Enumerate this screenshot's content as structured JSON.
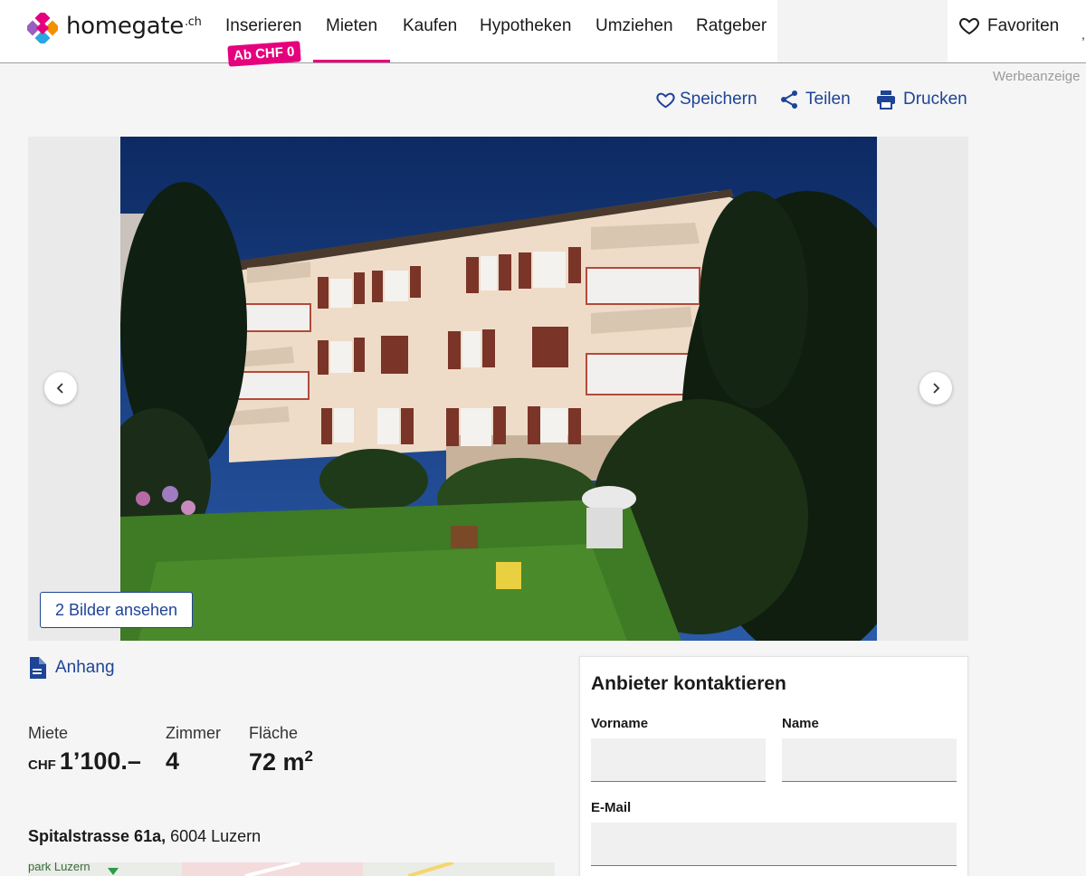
{
  "header": {
    "logo_text": "homegate",
    "logo_tld": ".ch",
    "nav": [
      "Inserieren",
      "Mieten",
      "Kaufen",
      "Hypotheken",
      "Umziehen",
      "Ratgeber"
    ],
    "badge": "Ab CHF 0",
    "favorites_label": "Favoriten",
    "edge_glyph": ","
  },
  "ad_label": "Werbeanzeige",
  "actions": {
    "save": "Speichern",
    "share": "Teilen",
    "print": "Drucken"
  },
  "gallery": {
    "view_button": "2 Bilder ansehen"
  },
  "attachment_label": "Anhang",
  "facts": {
    "rent_label": "Miete",
    "rent_currency": "CHF",
    "rent_value": "1’100.–",
    "rooms_label": "Zimmer",
    "rooms_value": "4",
    "area_label": "Fläche",
    "area_value": "72 m",
    "area_sup": "2"
  },
  "address": {
    "street": "Spitalstrasse 61a,",
    "city": " 6004 Luzern"
  },
  "map": {
    "label": "park Luzern"
  },
  "contact": {
    "title": "Anbieter kontaktieren",
    "first_name_label": "Vorname",
    "last_name_label": "Name",
    "email_label": "E-Mail",
    "first_name_value": "",
    "last_name_value": "",
    "email_value": ""
  },
  "colors": {
    "brand_pink": "#e5007d",
    "link_blue": "#1e4496"
  }
}
